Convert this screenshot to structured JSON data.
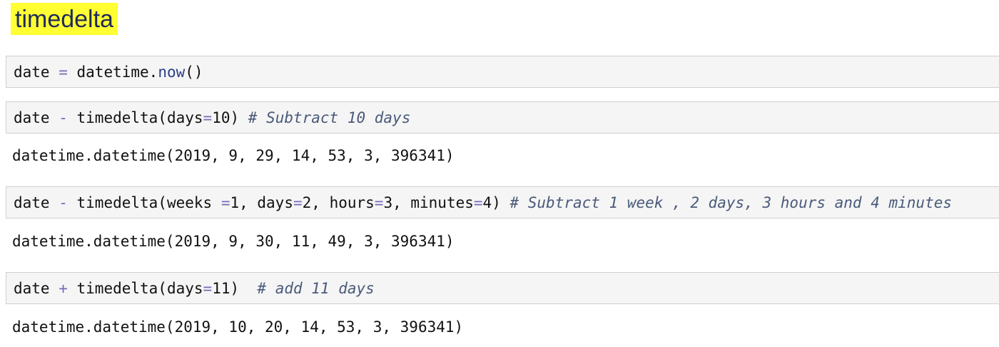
{
  "heading": "timedelta",
  "cells": [
    {
      "tokens": [
        {
          "t": "date ",
          "k": "plain"
        },
        {
          "t": "=",
          "k": "op"
        },
        {
          "t": " datetime.",
          "k": "plain"
        },
        {
          "t": "now",
          "k": "fn"
        },
        {
          "t": "()",
          "k": "plain"
        }
      ]
    },
    {
      "tokens": [
        {
          "t": "date ",
          "k": "plain"
        },
        {
          "t": "-",
          "k": "op"
        },
        {
          "t": " timedelta(days",
          "k": "plain"
        },
        {
          "t": "=",
          "k": "op"
        },
        {
          "t": "10) ",
          "k": "plain"
        },
        {
          "t": "# Subtract 10 days",
          "k": "cm"
        }
      ]
    },
    {
      "tokens": [
        {
          "t": "date ",
          "k": "plain"
        },
        {
          "t": "-",
          "k": "op"
        },
        {
          "t": " timedelta(weeks ",
          "k": "plain"
        },
        {
          "t": "=",
          "k": "op"
        },
        {
          "t": "1, days",
          "k": "plain"
        },
        {
          "t": "=",
          "k": "op"
        },
        {
          "t": "2, hours",
          "k": "plain"
        },
        {
          "t": "=",
          "k": "op"
        },
        {
          "t": "3, minutes",
          "k": "plain"
        },
        {
          "t": "=",
          "k": "op"
        },
        {
          "t": "4) ",
          "k": "plain"
        },
        {
          "t": "# Subtract 1 week , 2 days, 3 hours and 4 minutes",
          "k": "cm"
        }
      ]
    },
    {
      "tokens": [
        {
          "t": "date ",
          "k": "plain"
        },
        {
          "t": "+",
          "k": "op"
        },
        {
          "t": " timedelta(days",
          "k": "plain"
        },
        {
          "t": "=",
          "k": "op"
        },
        {
          "t": "11)  ",
          "k": "plain"
        },
        {
          "t": "# add 11 days",
          "k": "cm"
        }
      ]
    }
  ],
  "outputs": [
    "datetime.datetime(2019, 9, 29, 14, 53, 3, 396341)",
    "datetime.datetime(2019, 9, 30, 11, 49, 3, 396341)",
    "datetime.datetime(2019, 10, 20, 14, 53, 3, 396341)"
  ]
}
